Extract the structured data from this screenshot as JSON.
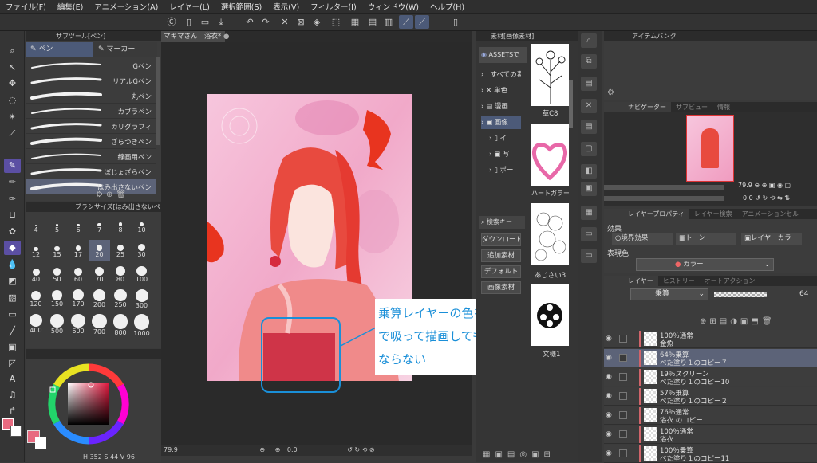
{
  "menu": [
    "ファイル(F)",
    "編集(E)",
    "アニメーション(A)",
    "レイヤー(L)",
    "選択範囲(S)",
    "表示(V)",
    "フィルター(I)",
    "ウィンドウ(W)",
    "ヘルプ(H)"
  ],
  "colors": {
    "accent": "#5b4fa3",
    "main_color": "#e86a80",
    "callout_border": "#1a8fd8"
  },
  "subtool": {
    "header": "サブツール[ペン]",
    "tabs": [
      "ペン",
      "マーカー"
    ],
    "brushes": [
      "Gペン",
      "リアルGペン",
      "丸ペン",
      "カブラペン",
      "カリグラフィ",
      "ざらつきペン",
      "線画用ペン",
      "ぼじょざらペン",
      "はみ出さないペン"
    ]
  },
  "brushsize": {
    "header": "ブラシサイズ[はみ出さないペン]",
    "sizes": [
      "4",
      "5",
      "6",
      "7",
      "8",
      "10",
      "12",
      "15",
      "17",
      "20",
      "25",
      "30",
      "40",
      "50",
      "60",
      "70",
      "80",
      "100",
      "120",
      "150",
      "170",
      "200",
      "250",
      "300",
      "400",
      "500",
      "600",
      "700",
      "800",
      "1000"
    ],
    "selected": "20"
  },
  "color_readout": {
    "h_label": "H",
    "h": "352",
    "s_label": "S",
    "s": "44",
    "v_label": "V",
    "v": "96"
  },
  "doc_tab": {
    "title": "マキマさん　浴衣*"
  },
  "canvas_status": {
    "zoom": "79.9",
    "angle": "0.0"
  },
  "callout": {
    "text": "乗算レイヤーの色をスポイトで吸って描画しても同じ色にならない"
  },
  "material": {
    "header": "素材[画像素材]",
    "assets": "ASSETSで",
    "tree": [
      "すべての素",
      "単色",
      "漫画",
      "画像",
      "イ",
      "写",
      "ポー"
    ],
    "search": "検索キー",
    "buttons": [
      "ダウンロード",
      "追加素材",
      "デフォルト",
      "画像素材"
    ],
    "thumbs": [
      "草C8",
      "ハートガラー",
      "あじさい3",
      "文様1"
    ]
  },
  "item_bank": {
    "header": "アイテムバンク"
  },
  "navigator": {
    "tabs": [
      "ナビゲーター",
      "サブビュー",
      "情報"
    ],
    "zoom": "79.9",
    "angle": "0.0"
  },
  "layer_property": {
    "tabs": [
      "レイヤープロパティ",
      "レイヤー検索",
      "アニメーションセル"
    ],
    "effect_label": "効果",
    "effects": [
      "境界効果",
      "トーン",
      "レイヤーカラー"
    ],
    "expression_label": "表現色",
    "expression": "カラー"
  },
  "layer_panel": {
    "tabs": [
      "レイヤー",
      "ヒストリー",
      "オートアクション"
    ],
    "blend": "乗算",
    "opacity": "64",
    "layers": [
      {
        "line1": "100％通常",
        "line2": "金魚"
      },
      {
        "line1": "64％乗算",
        "line2": "べた塗り１のコピー７"
      },
      {
        "line1": "19％スクリーン",
        "line2": "べた塗り１のコピー10"
      },
      {
        "line1": "57％乗算",
        "line2": "べた塗り１のコピー２"
      },
      {
        "line1": "76％通常",
        "line2": "浴衣 のコピー"
      },
      {
        "line1": "100％通常",
        "line2": "浴衣"
      },
      {
        "line1": "100％乗算",
        "line2": "べた塗り１のコピー11"
      }
    ]
  }
}
